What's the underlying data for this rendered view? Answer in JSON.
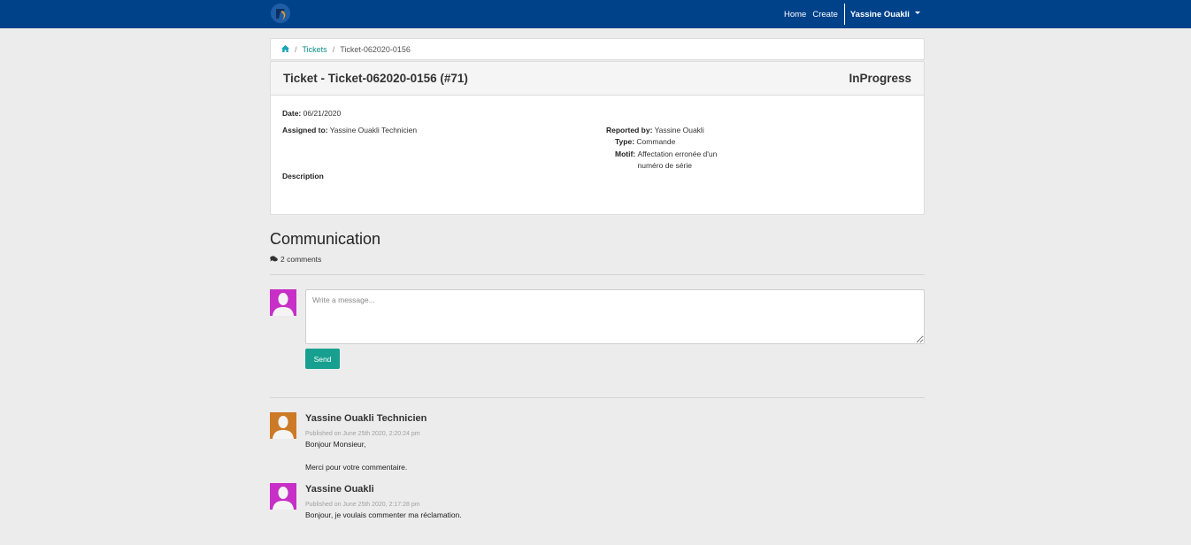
{
  "navbar": {
    "logo_icon": "app-logo-icon",
    "links": [
      "Home",
      "Create"
    ],
    "user": "Yassine Ouakli",
    "colors": {
      "background": "#00428a"
    }
  },
  "breadcrumb": {
    "home_icon": "home-icon",
    "items": [
      "Tickets",
      "Ticket-062020-0156"
    ]
  },
  "ticket": {
    "title": "Ticket - Ticket-062020-0156 (#71)",
    "status": "InProgress",
    "date_label": "Date:",
    "date": "06/21/2020",
    "assigned_label": "Assigned to:",
    "assigned": "Yassine Ouakli Technicien",
    "reported_label": "Reported by:",
    "reported": "Yassine Ouakli",
    "type_label": "Type:",
    "type": "Commande",
    "motif_label": "Motif:",
    "motif": "Affectation erronée d'un numéro de série",
    "description_label": "Description"
  },
  "communication": {
    "title": "Communication",
    "count": "2 comments",
    "input_placeholder": "Write a message...",
    "send_label": "Send",
    "colors": {
      "send": "#17a08f"
    }
  },
  "comments": [
    {
      "author": "Yassine Ouakli Technicien",
      "published": "Published on June 25th 2020, 2:20:24 pm",
      "body": "Bonjour Monsieur,\n\nMerci pour votre commentaire.",
      "avatar_color": "#cc7a25"
    },
    {
      "author": "Yassine Ouakli",
      "published": "Published on June 25th 2020, 2:17:28 pm",
      "body": "Bonjour, je voulais commenter ma réclamation.",
      "avatar_color": "#c72fc7"
    }
  ],
  "current_user_avatar_color": "#c72fc7"
}
